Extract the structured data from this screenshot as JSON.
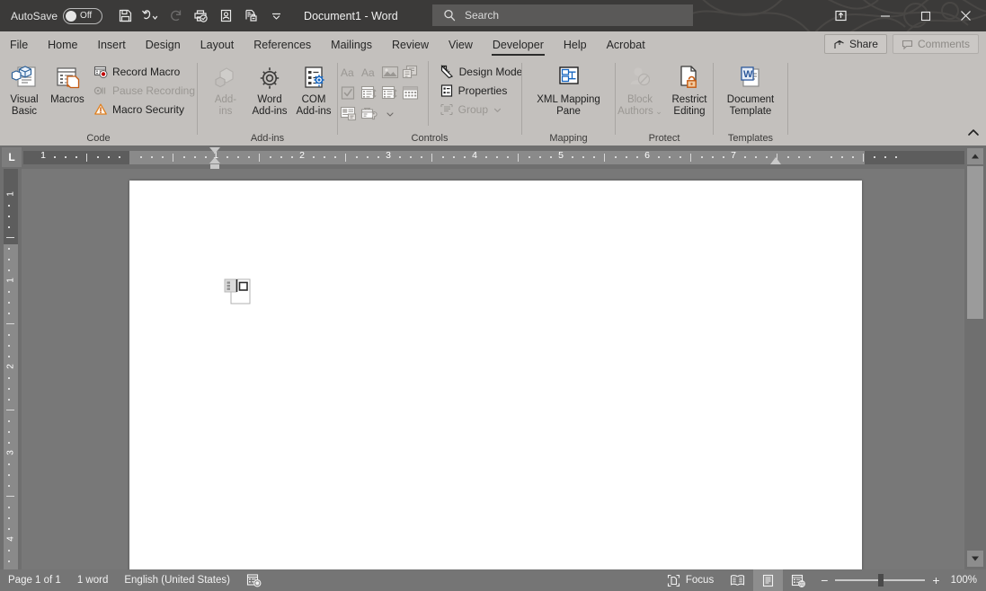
{
  "titlebar": {
    "autosave_label": "AutoSave",
    "autosave_state": "Off",
    "document_title": "Document1  -  Word",
    "quick_access": [
      {
        "name": "save-icon",
        "label": "Save",
        "disabled": false
      },
      {
        "name": "undo-icon",
        "label": "Undo",
        "disabled": false
      },
      {
        "name": "redo-icon",
        "label": "Redo",
        "disabled": true
      },
      {
        "name": "quick-print-icon",
        "label": "Quick Print",
        "disabled": false
      },
      {
        "name": "read-aloud-icon",
        "label": "Read Aloud",
        "disabled": false
      },
      {
        "name": "print-preview-icon",
        "label": "Print Preview and Print",
        "disabled": false
      },
      {
        "name": "customize-qat-icon",
        "label": "Customize Quick Access Toolbar",
        "disabled": false
      }
    ],
    "window_controls": {
      "ribbon_display": "Ribbon Display Options",
      "minimize": "Minimize",
      "maximize": "Restore Down",
      "close": "Close"
    }
  },
  "search": {
    "placeholder": "Search"
  },
  "tabs": [
    {
      "label": "File",
      "active": false
    },
    {
      "label": "Home",
      "active": false
    },
    {
      "label": "Insert",
      "active": false
    },
    {
      "label": "Design",
      "active": false
    },
    {
      "label": "Layout",
      "active": false
    },
    {
      "label": "References",
      "active": false
    },
    {
      "label": "Mailings",
      "active": false
    },
    {
      "label": "Review",
      "active": false
    },
    {
      "label": "View",
      "active": false
    },
    {
      "label": "Developer",
      "active": true
    },
    {
      "label": "Help",
      "active": false
    },
    {
      "label": "Acrobat",
      "active": false
    }
  ],
  "tab_actions": {
    "share_label": "Share",
    "comments_label": "Comments"
  },
  "ribbon": {
    "groups": [
      {
        "name": "code",
        "label": "Code",
        "big_buttons": [
          {
            "label_line1": "Visual",
            "label_line2": "Basic",
            "icon": "visual-basic-icon",
            "disabled": false
          },
          {
            "label_line1": "Macros",
            "label_line2": "",
            "icon": "macros-icon",
            "disabled": false
          }
        ],
        "small_buttons": [
          {
            "label": "Record Macro",
            "icon": "record-macro-icon",
            "disabled": false
          },
          {
            "label": "Pause Recording",
            "icon": "pause-recording-icon",
            "disabled": true
          },
          {
            "label": "Macro Security",
            "icon": "macro-security-icon",
            "disabled": false
          }
        ]
      },
      {
        "name": "add-ins",
        "label": "Add-ins",
        "big_buttons": [
          {
            "label_line1": "Add-",
            "label_line2": "ins",
            "icon": "add-ins-icon",
            "disabled": true
          },
          {
            "label_line1": "Word",
            "label_line2": "Add-ins",
            "icon": "word-add-ins-icon",
            "disabled": false
          },
          {
            "label_line1": "COM",
            "label_line2": "Add-ins",
            "icon": "com-add-ins-icon",
            "disabled": false
          }
        ],
        "small_buttons": []
      },
      {
        "name": "controls",
        "label": "Controls",
        "control_grid": [
          {
            "name": "rich-text-content-control-icon",
            "disabled": true
          },
          {
            "name": "plain-text-content-control-icon",
            "disabled": true
          },
          {
            "name": "picture-content-control-icon",
            "disabled": true
          },
          {
            "name": "building-block-gallery-content-control-icon",
            "disabled": true
          },
          {
            "name": "check-box-content-control-icon",
            "disabled": true
          },
          {
            "name": "combo-box-content-control-icon",
            "disabled": true
          },
          {
            "name": "drop-down-list-content-control-icon",
            "disabled": true
          },
          {
            "name": "date-picker-content-control-icon",
            "disabled": true
          },
          {
            "name": "repeating-section-content-control-icon",
            "disabled": true
          },
          {
            "name": "legacy-tools-icon",
            "disabled": true
          }
        ],
        "small_buttons": [
          {
            "label": "Design Mode",
            "icon": "design-mode-icon",
            "disabled": false
          },
          {
            "label": "Properties",
            "icon": "properties-icon",
            "disabled": false
          },
          {
            "label": "Group",
            "icon": "group-icon",
            "disabled": true
          }
        ]
      },
      {
        "name": "mapping",
        "label": "Mapping",
        "big_buttons": [
          {
            "label_line1": "XML Mapping",
            "label_line2": "Pane",
            "icon": "xml-mapping-pane-icon",
            "disabled": false
          }
        ],
        "small_buttons": []
      },
      {
        "name": "protect",
        "label": "Protect",
        "big_buttons": [
          {
            "label_line1": "Block",
            "label_line2": "Authors",
            "icon": "block-authors-icon",
            "disabled": true
          },
          {
            "label_line1": "Restrict",
            "label_line2": "Editing",
            "icon": "restrict-editing-icon",
            "disabled": false
          }
        ],
        "small_buttons": []
      },
      {
        "name": "templates",
        "label": "Templates",
        "big_buttons": [
          {
            "label_line1": "Document",
            "label_line2": "Template",
            "icon": "document-template-icon",
            "disabled": false
          }
        ],
        "small_buttons": []
      }
    ],
    "collapse_label": "Collapse the Ribbon"
  },
  "ruler": {
    "tab_selector": "L",
    "horizontal_numbers": [
      1,
      1,
      2,
      3,
      4,
      5,
      6,
      7
    ],
    "vertical_numbers": [
      1,
      1,
      2,
      3
    ]
  },
  "document": {
    "object_name": "embedded-object-placeholder"
  },
  "statusbar": {
    "page": "Page 1 of 1",
    "words": "1 word",
    "language": "English (United States)",
    "accessibility_icon": "accessibility-checker-icon",
    "focus_label": "Focus",
    "views": [
      {
        "name": "read-mode-view-button",
        "active": false
      },
      {
        "name": "print-layout-view-button",
        "active": true
      },
      {
        "name": "web-layout-view-button",
        "active": false
      }
    ],
    "zoom_out": "−",
    "zoom_in": "+",
    "zoom_level": "100%"
  }
}
